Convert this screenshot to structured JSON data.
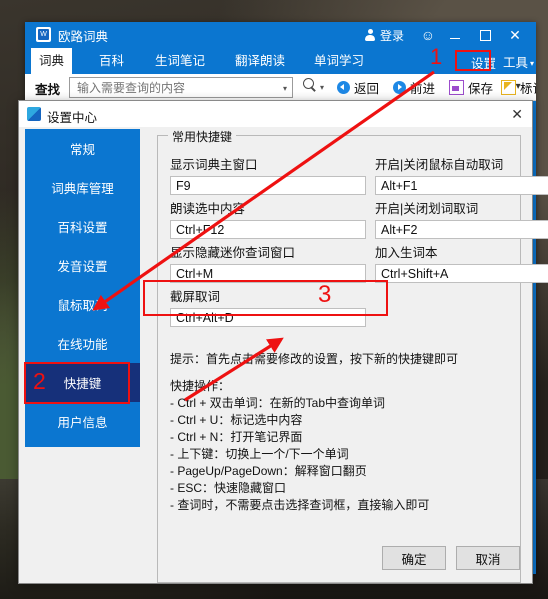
{
  "app": {
    "title": "欧路词典",
    "icon": "dictionary-icon",
    "titlebar": {
      "login_label": "登录",
      "smiley_icon": "smiley-icon",
      "minimize_icon": "minimize-icon",
      "maximize_icon": "maximize-icon",
      "close_icon": "close-icon"
    },
    "tabs": [
      {
        "label": "词典",
        "active": true
      },
      {
        "label": "百科",
        "active": false
      },
      {
        "label": "生词笔记",
        "active": false
      },
      {
        "label": "翻译朗读",
        "active": false
      },
      {
        "label": "单词学习",
        "active": false
      }
    ],
    "tab_right_controls": {
      "settings_label": "设置",
      "tools_label": "工具",
      "tools_caret": "▾"
    },
    "toolbar": {
      "find_label": "查找",
      "search_placeholder": "输入需要查询的内容",
      "search_value": "",
      "search_caret": "▾",
      "magnifier_icon": "search-icon",
      "magnifier_caret": "▾",
      "items": [
        {
          "label": "返回",
          "icon": "back-arrow-icon"
        },
        {
          "label": "前进",
          "icon": "forward-arrow-icon"
        },
        {
          "label": "保存",
          "icon": "save-disk-icon"
        },
        {
          "label": "标记",
          "icon": "marker-icon"
        }
      ],
      "overflow": "▾ »"
    }
  },
  "dialog": {
    "title": "设置中心",
    "icon": "settings-center-icon",
    "close_icon": "close-icon",
    "sidebar": [
      {
        "label": "常规",
        "active": false
      },
      {
        "label": "词典库管理",
        "active": false
      },
      {
        "label": "百科设置",
        "active": false
      },
      {
        "label": "发音设置",
        "active": false
      },
      {
        "label": "鼠标取词",
        "active": false
      },
      {
        "label": "在线功能",
        "active": false
      },
      {
        "label": "快捷键",
        "active": true
      },
      {
        "label": "用户信息",
        "active": false
      }
    ],
    "group_legend": "常用快捷键",
    "fields": [
      {
        "label": "显示词典主窗口",
        "value": "F9"
      },
      {
        "label": "开启|关闭鼠标自动取词",
        "value": "Alt+F1"
      },
      {
        "label": "朗读选中内容",
        "value": "Ctrl+F12"
      },
      {
        "label": "开启|关闭划词取词",
        "value": "Alt+F2"
      },
      {
        "label": "显示隐藏迷你查词窗口",
        "value": "Ctrl+M"
      },
      {
        "label": "加入生词本",
        "value": "Ctrl+Shift+A"
      },
      {
        "label": "截屏取词",
        "value": "Ctrl+Alt+D"
      }
    ],
    "hint": "提示：首先点击需要修改的设置，按下新的快捷键即可",
    "ops_title": "快捷操作：",
    "ops_lines": [
      "- Ctrl + 双击单词：在新的Tab中查询单词",
      "- Ctrl + U：标记选中内容",
      "- Ctrl + N：打开笔记界面",
      "- 上下键：切换上一个/下一个单词",
      "- PageUp/PageDown：解释窗口翻页",
      "- ESC：快速隐藏窗口",
      "- 查词时，不需要点击选择查词框，直接输入即可"
    ],
    "buttons": {
      "ok": "确定",
      "cancel": "取消"
    }
  },
  "annotations": {
    "color": "#ee1111",
    "steps": [
      {
        "number": "1",
        "target": "settings-menu-button"
      },
      {
        "number": "2",
        "target": "sidebar-item-hotkeys"
      },
      {
        "number": "3",
        "target": "screen-capture-hotkey-field"
      }
    ]
  }
}
